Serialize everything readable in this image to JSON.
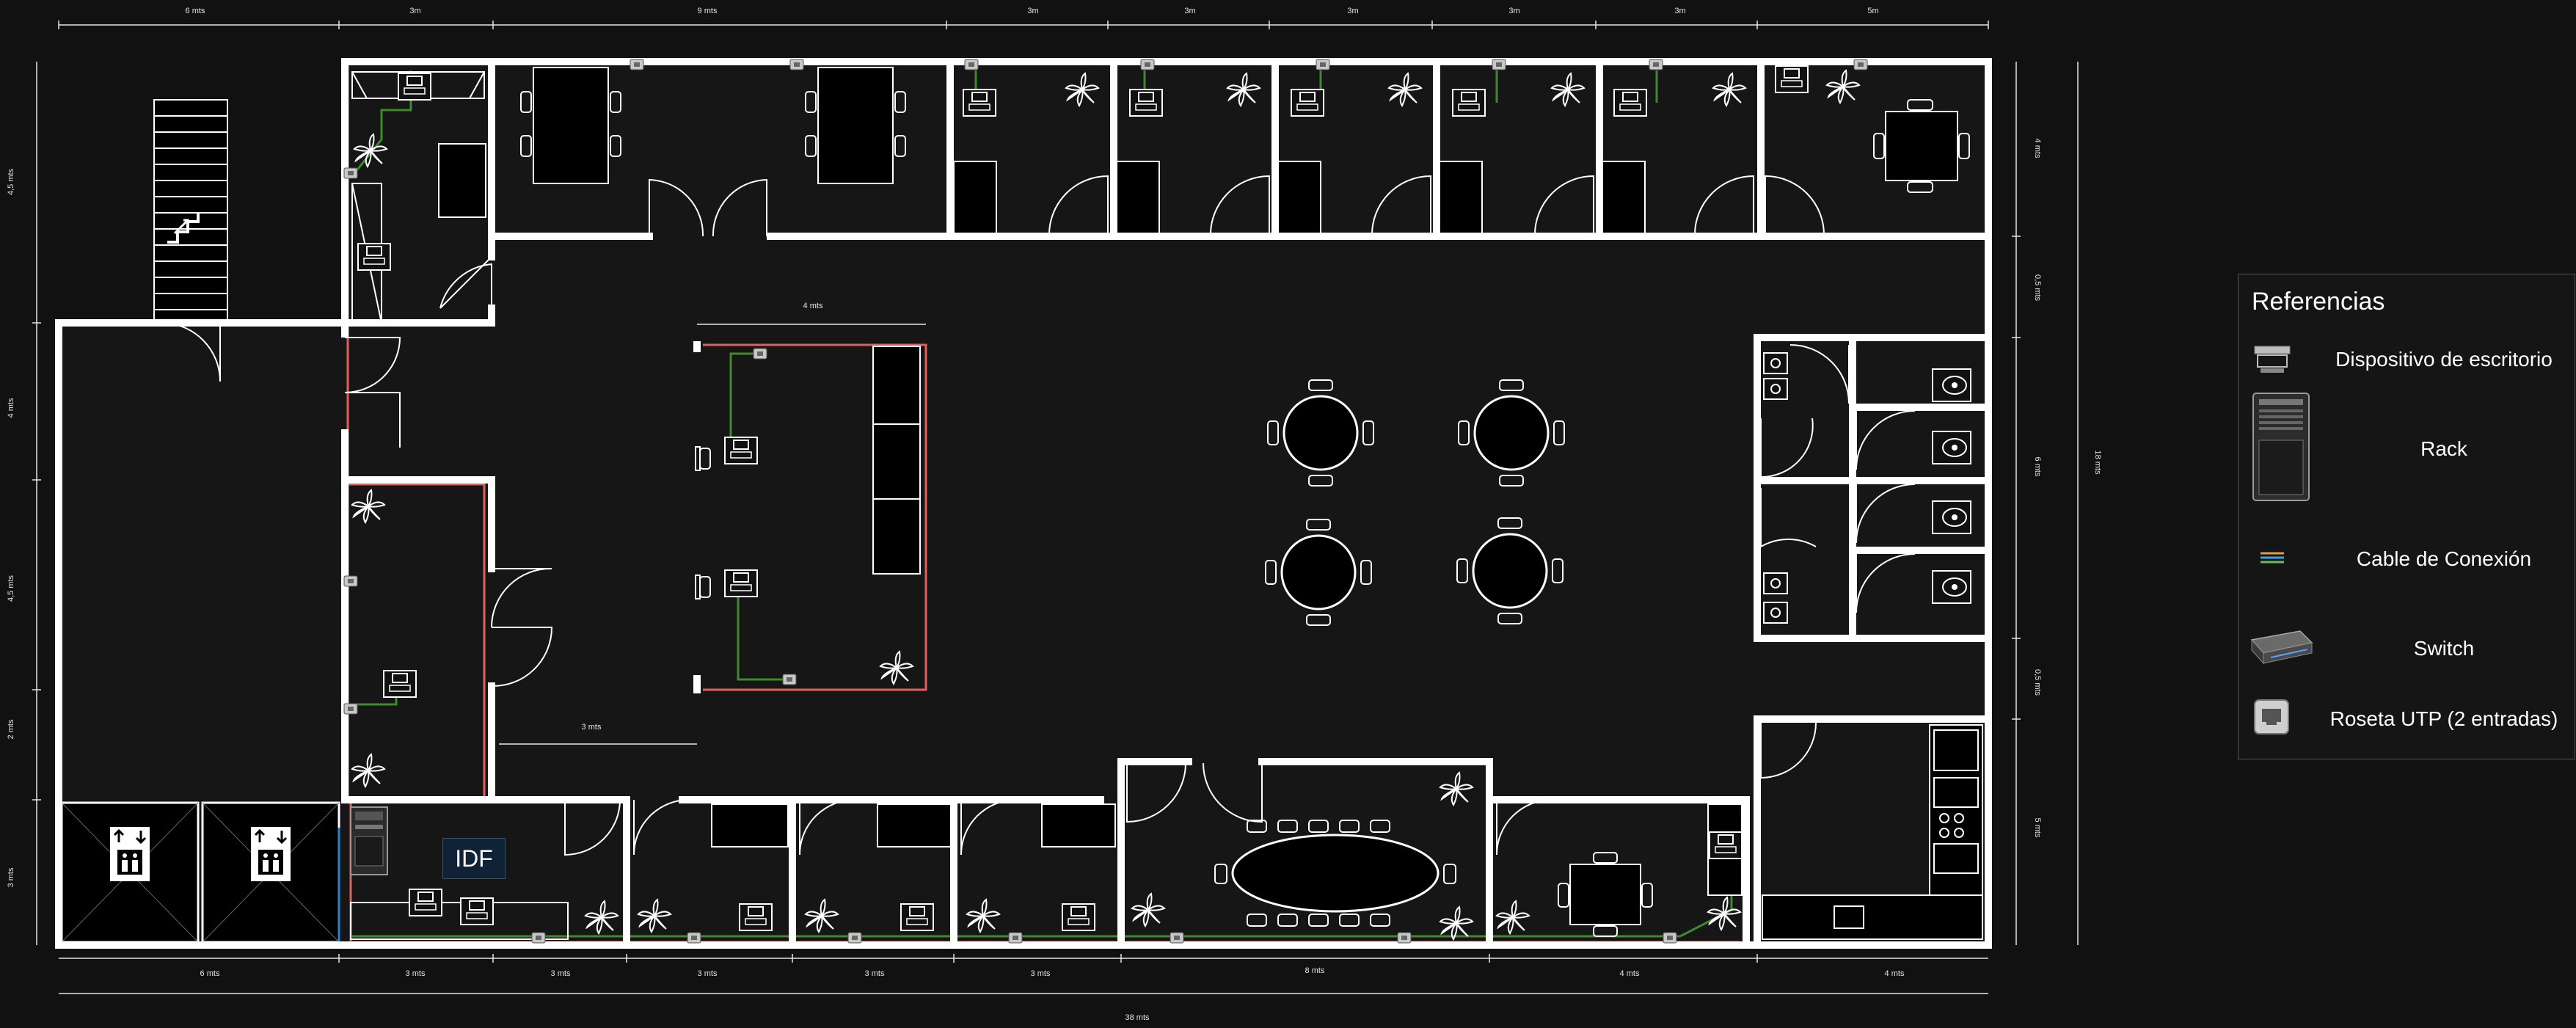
{
  "dimensions": {
    "top": [
      "6 mts",
      "3m",
      "9 mts",
      "3m",
      "3m",
      "3m",
      "3m",
      "3m",
      "5m"
    ],
    "bottom": [
      "6 mts",
      "3 mts",
      "3 mts",
      "3 mts",
      "3 mts",
      "3 mts",
      "8 mts",
      "4 mts",
      "4 mts"
    ],
    "total_width": "38 mts",
    "left": [
      "4,5 mts",
      "4 mts",
      "4,5 mts",
      "2 mts",
      "3 mts"
    ],
    "right": [
      "4 mts",
      "0,5 mts",
      "6 mts",
      "0,5 mts",
      "5 mts"
    ],
    "total_height": "18 mts",
    "interior_top": "4 mts",
    "interior_mid": "3 mts"
  },
  "rooms": {
    "idf_label": "IDF"
  },
  "legend": {
    "title": "Referencias",
    "items": [
      {
        "label": "Dispositivo de escritorio",
        "icon": "desktop-device-icon"
      },
      {
        "label": "Rack",
        "icon": "rack-icon"
      },
      {
        "label": "Cable de Conexión",
        "icon": "cable-icon"
      },
      {
        "label": "Switch",
        "icon": "switch-icon"
      },
      {
        "label": "Roseta UTP (2 entradas)",
        "icon": "utp-outlet-icon"
      }
    ]
  },
  "colors": {
    "background": "#111111",
    "wall": "#ffffff",
    "floor": "#151515",
    "cable_red": "#e06060",
    "cable_green": "#3f8a2e",
    "cable_blue": "#2f7fd0",
    "outlet": "#c8c8c8"
  }
}
